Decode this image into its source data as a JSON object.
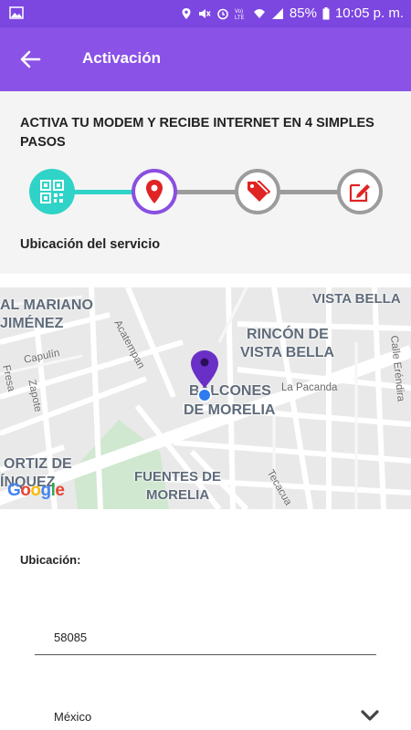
{
  "status_bar": {
    "battery": "85%",
    "time": "10:05 p. m."
  },
  "app_bar": {
    "title": "Activación"
  },
  "steps": {
    "heading": "ACTIVA TU MODEM Y RECIBE INTERNET EN 4 SIMPLES PASOS",
    "current_label": "Ubicación del servicio",
    "icons": [
      "qr-code-icon",
      "location-pin-icon",
      "price-tags-icon",
      "edit-icon"
    ]
  },
  "map": {
    "neighborhoods": [
      "AL MARIANO",
      "JIMÉNEZ",
      "VISTA BELLA",
      "RINCÓN DE",
      "VISTA BELLA",
      "BALCONES",
      "DE MORELIA",
      "ORTIZ DE",
      "ÍNQUEZ",
      "FUENTES DE",
      "MORELIA"
    ],
    "streets": [
      "Acatempan",
      "Capulín",
      "Fresa",
      "Zapote",
      "La Pacanda",
      "Calle Eréndira",
      "Tecacua"
    ],
    "logo": "Google"
  },
  "form": {
    "location_label": "Ubicación:",
    "postal_code": "58085",
    "country": "México"
  },
  "colors": {
    "primary": "#8a52e6",
    "status_bar": "#7c46e1",
    "step_done": "#2fd3c7",
    "step_inactive": "#9c9c9c",
    "pin": "#6a2fc6",
    "step_icon_red": "#e02424"
  }
}
